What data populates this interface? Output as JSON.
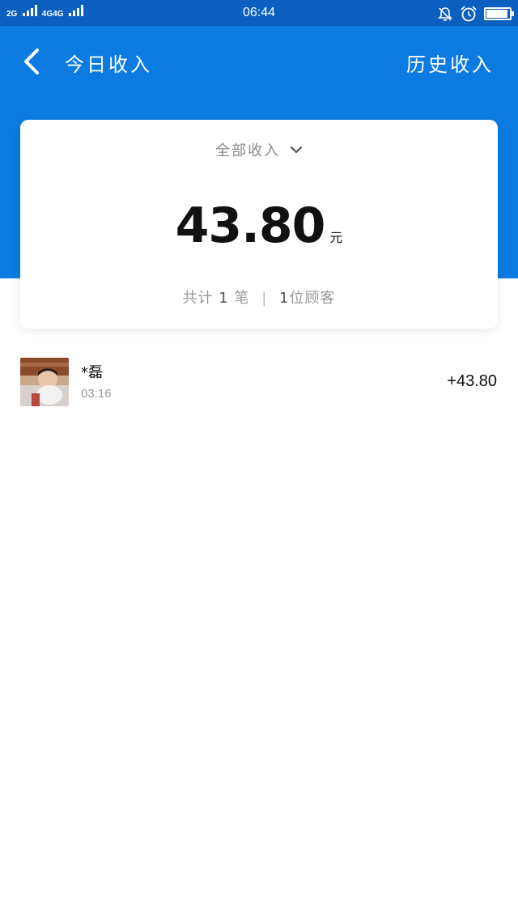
{
  "status_bar": {
    "sim1": "2G",
    "sim2": "4G",
    "sim3": "4G",
    "time": "06:44",
    "icons": [
      "bell-muted-icon",
      "alarm-icon",
      "battery-icon"
    ]
  },
  "header": {
    "back_icon": "chevron-left-icon",
    "title": "今日收入",
    "history_label": "历史收入",
    "color": "#0b7be2"
  },
  "summary_card": {
    "filter_label": "全部收入",
    "amount": "43.80",
    "unit": "元",
    "count_prefix": "共计",
    "count": "1",
    "count_unit": "笔",
    "customer_count": "1",
    "customer_unit": "位顾客"
  },
  "transactions": [
    {
      "name": "*磊",
      "time": "03:16",
      "amount": "+43.80"
    }
  ]
}
